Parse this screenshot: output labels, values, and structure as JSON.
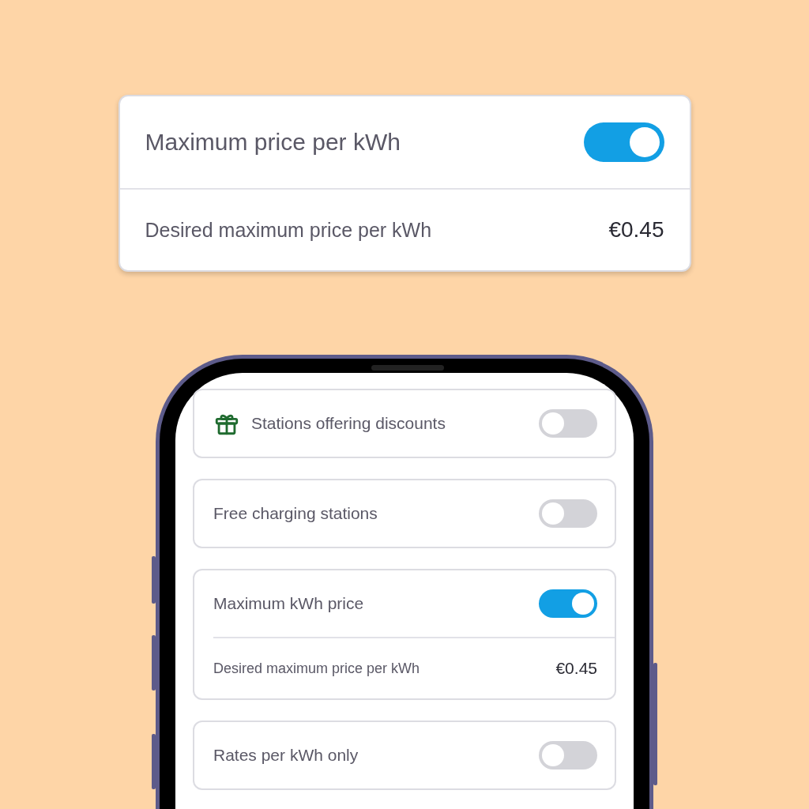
{
  "highlight_card": {
    "title": "Maximum price per kWh",
    "on": true,
    "detail_label": "Desired maximum price per kWh",
    "detail_value": "€0.45"
  },
  "phone": {
    "settings": [
      {
        "kind": "with_icon",
        "label": "Stations offering discounts",
        "on": false
      },
      {
        "kind": "plain",
        "label": "Free charging stations",
        "on": false
      },
      {
        "kind": "with_detail",
        "label": "Maximum kWh price",
        "on": true,
        "detail_label": "Desired maximum price per kWh",
        "detail_value": "€0.45"
      },
      {
        "kind": "plain",
        "label": "Rates per kWh only",
        "on": false
      }
    ]
  }
}
